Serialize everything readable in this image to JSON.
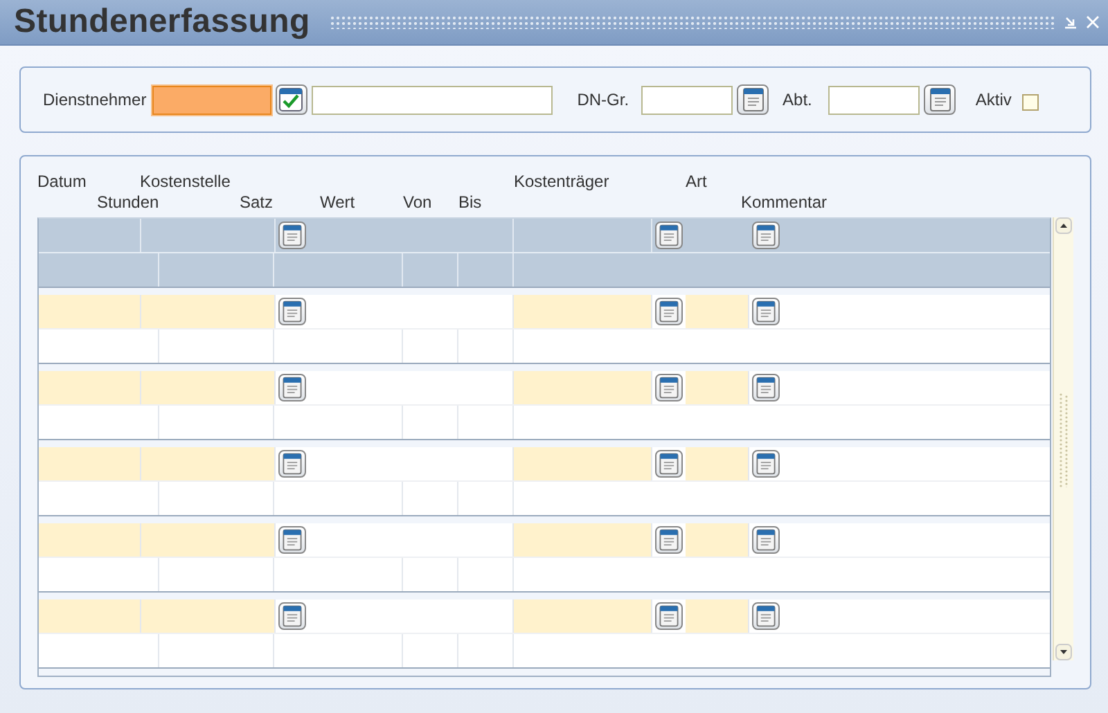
{
  "window": {
    "title": "Stundenerfassung"
  },
  "filter": {
    "employee_label": "Dienstnehmer",
    "employee_focused": true,
    "group_label": "DN-Gr.",
    "department_label": "Abt.",
    "active_label": "Aktiv",
    "active_checked": false
  },
  "table": {
    "header_row_1": [
      "Datum",
      "Kostenstelle",
      "Kostenträger",
      "Art"
    ],
    "header_row_2": [
      "Stunden",
      "Satz",
      "Wert",
      "Von",
      "Bis",
      "Kommentar"
    ]
  }
}
